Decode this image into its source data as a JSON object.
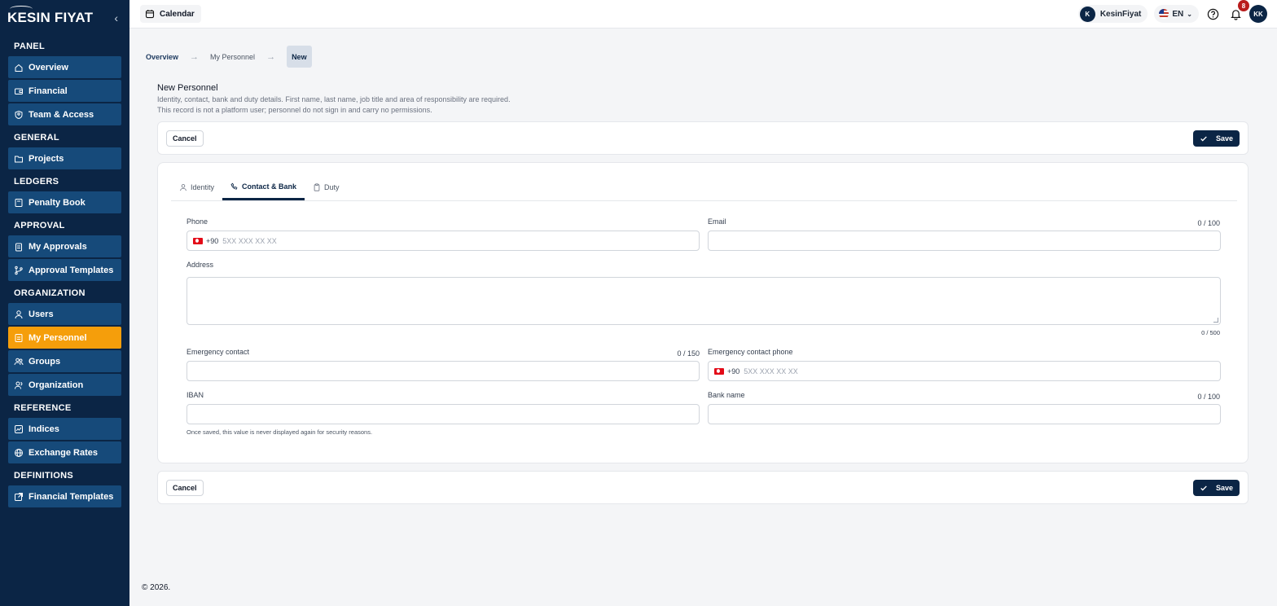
{
  "app": {
    "logo": "KESIN FIYAT"
  },
  "sidebar": {
    "sections": [
      {
        "title": "PANEL",
        "items": [
          {
            "label": "Overview",
            "icon": "home-icon"
          },
          {
            "label": "Financial",
            "icon": "wallet-icon"
          },
          {
            "label": "Team & Access",
            "icon": "user-shield-icon"
          }
        ]
      },
      {
        "title": "GENERAL",
        "items": [
          {
            "label": "Projects",
            "icon": "folder-icon"
          }
        ]
      },
      {
        "title": "LEDGERS",
        "items": [
          {
            "label": "Penalty Book",
            "icon": "book-icon"
          }
        ]
      },
      {
        "title": "APPROVAL",
        "items": [
          {
            "label": "My Approvals",
            "icon": "clipboard-icon"
          },
          {
            "label": "Approval Templates",
            "icon": "git-branch-icon"
          }
        ]
      },
      {
        "title": "ORGANIZATION",
        "items": [
          {
            "label": "Users",
            "icon": "user-icon"
          },
          {
            "label": "My Personnel",
            "icon": "id-card-icon",
            "active": true
          },
          {
            "label": "Groups",
            "icon": "users-icon"
          },
          {
            "label": "Organization",
            "icon": "user-group-icon"
          }
        ]
      },
      {
        "title": "REFERENCE",
        "items": [
          {
            "label": "Indices",
            "icon": "chart-line-icon"
          },
          {
            "label": "Exchange Rates",
            "icon": "globe-icon"
          }
        ]
      },
      {
        "title": "DEFINITIONS",
        "items": [
          {
            "label": "Financial Templates",
            "icon": "external-link-icon"
          }
        ]
      }
    ]
  },
  "topbar": {
    "calendar_label": "Calendar",
    "user_initial": "K",
    "user_name": "KesinFiyat",
    "language": "EN",
    "notification_count": "8",
    "avatar_initials": "KK"
  },
  "breadcrumb": {
    "first": "Overview",
    "second": "My Personnel",
    "current": "New"
  },
  "page": {
    "title": "New Personnel",
    "desc_line1": "Identity, contact, bank and duty details. First name, last name, job title and area of responsibility are required.",
    "desc_line2": "This record is not a platform user; personnel do not sign in and carry no permissions."
  },
  "actions": {
    "cancel": "Cancel",
    "save": "Save"
  },
  "tabs": [
    {
      "label": "Identity",
      "icon": "user-icon"
    },
    {
      "label": "Contact & Bank",
      "icon": "phone-icon",
      "active": true
    },
    {
      "label": "Duty",
      "icon": "clipboard-icon"
    }
  ],
  "form": {
    "phone": {
      "label": "Phone",
      "dial": "+90",
      "placeholder": "5XX XXX XX XX"
    },
    "email": {
      "label": "Email",
      "counter": "0 / 100",
      "value": ""
    },
    "address": {
      "label": "Address",
      "counter": "0 / 500",
      "value": ""
    },
    "emergency_contact": {
      "label": "Emergency contact",
      "counter": "0 / 150",
      "value": ""
    },
    "emergency_phone": {
      "label": "Emergency contact phone",
      "dial": "+90",
      "placeholder": "5XX XXX XX XX"
    },
    "iban": {
      "label": "IBAN",
      "value": "",
      "hint": "Once saved, this value is never displayed again for security reasons."
    },
    "bank_name": {
      "label": "Bank name",
      "counter": "0 / 100",
      "value": ""
    }
  },
  "footer": {
    "text": "© 2026."
  }
}
